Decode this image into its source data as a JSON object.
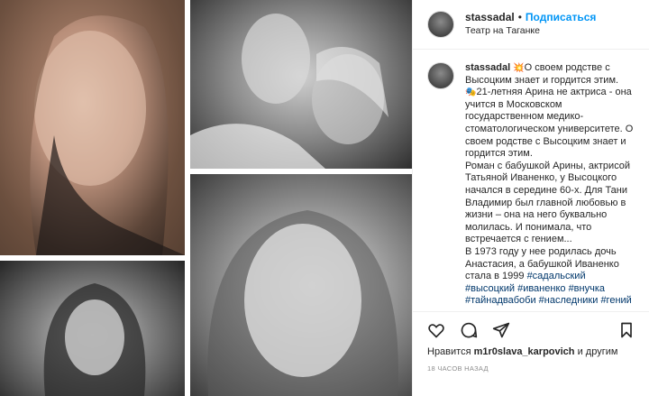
{
  "post": {
    "username": "stassadal",
    "dot": "•",
    "follow_label": "Подписаться",
    "location": "Театр на Таганке"
  },
  "caption": {
    "username": "stassadal",
    "emoji_1": "💥",
    "line_1": "О своем родстве с Высоцким знает и гордится этим.",
    "emoji_2": "🎭",
    "body": "21-летняя Арина не актриса - она учится в Московском государственном медико-стоматологическом университете. О своем родстве с Высоцким знает и гордится этим.",
    "para_2": "Роман с бабушкой Арины, актрисой Татьяной Иваненко, у Высоцкого начался в середине 60-х. Для Тани Владимир был главной любовью в жизни – она на него буквально молилась. И понимала, что встречается с гением...",
    "para_3": "В 1973 году у нее родилась дочь Анастасия, а бабушкой Иваненко стала в 1999",
    "hashtags": [
      "#садальский",
      "#высоцкий",
      "#иваненко",
      "#внучка",
      "#тайнадвабоби",
      "#наследники",
      "#гений"
    ]
  },
  "actions": {
    "like_icon": "heart-icon",
    "comment_icon": "comment-icon",
    "share_icon": "share-icon",
    "save_icon": "bookmark-icon"
  },
  "likes": {
    "prefix": "Нравится",
    "user": "m1r0slava_karpovich",
    "suffix": "и другим"
  },
  "time": "18 ЧАСОВ НАЗАД",
  "colors": {
    "link": "#0095f6",
    "hashtag": "#00376b",
    "border": "#efefef",
    "muted": "#8e8e8e"
  }
}
